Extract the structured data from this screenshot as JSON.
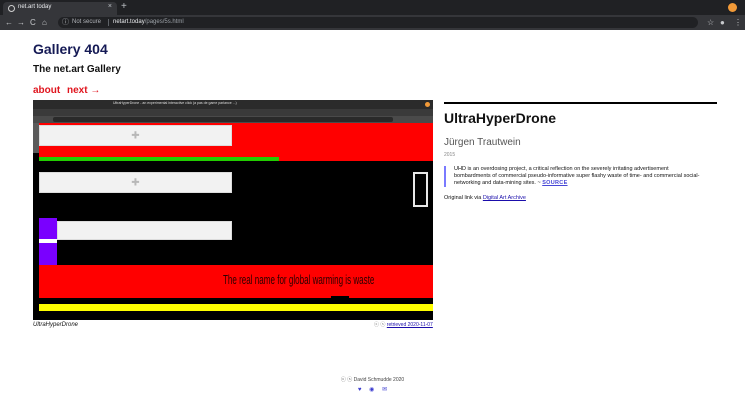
{
  "browser": {
    "tab_title": "net.art today",
    "tab_close": "×",
    "new_tab": "+",
    "nav_back": "←",
    "nav_forward": "→",
    "nav_reload": "C",
    "nav_home": "⌂",
    "security_icon": "ⓘ",
    "security_text": "Not secure",
    "url_domain": "netart.today",
    "url_path": "/pages/5s.html",
    "star_icon": "☆",
    "account_icon": "●",
    "menu_icon": "⋮"
  },
  "site": {
    "title": "Gallery 404",
    "subtitle": "The net.art Gallery",
    "nav": {
      "about": "about",
      "next": "next →"
    }
  },
  "artwork": {
    "screenshot_tab_title": "UltraHyperDrone - an experimental interactive click (a pas de game parlance ...)",
    "overlay_text": "The real name for global warming is waste",
    "caption": "UltraHyperDrone",
    "retrieved_cc": "ⓒ ⓢ",
    "retrieved_text": "retrieved 2020-11-07"
  },
  "info": {
    "title": "UltraHyperDrone",
    "artist": "Jürgen Trautwein",
    "year": "2015",
    "description": "UHD is an overdosing project, a critical reflection on the severely irritating advertisement bombardments of commercial pseudo-informative super flashy waste of time- and commercial social-networking and data-mining sites. ~ ",
    "source_label": "SOURCE",
    "original_prefix": "Original link via ",
    "original_link": "Digital Art Archive"
  },
  "footer": {
    "copyright": "ⓒ ⓢ David Schmudde 2020",
    "icons": [
      "twitter-icon",
      "mastodon-icon",
      "email-icon"
    ],
    "icon_glyphs": [
      "♥",
      "◉",
      "✉"
    ]
  },
  "colors": {
    "title_navy": "#151a55",
    "nav_red": "#e0151e",
    "art_red": "#ff0000",
    "art_green": "#22cc00",
    "art_purple": "#7a00ff",
    "art_yellow": "#ffff00",
    "link_blue": "#1a0dab"
  }
}
